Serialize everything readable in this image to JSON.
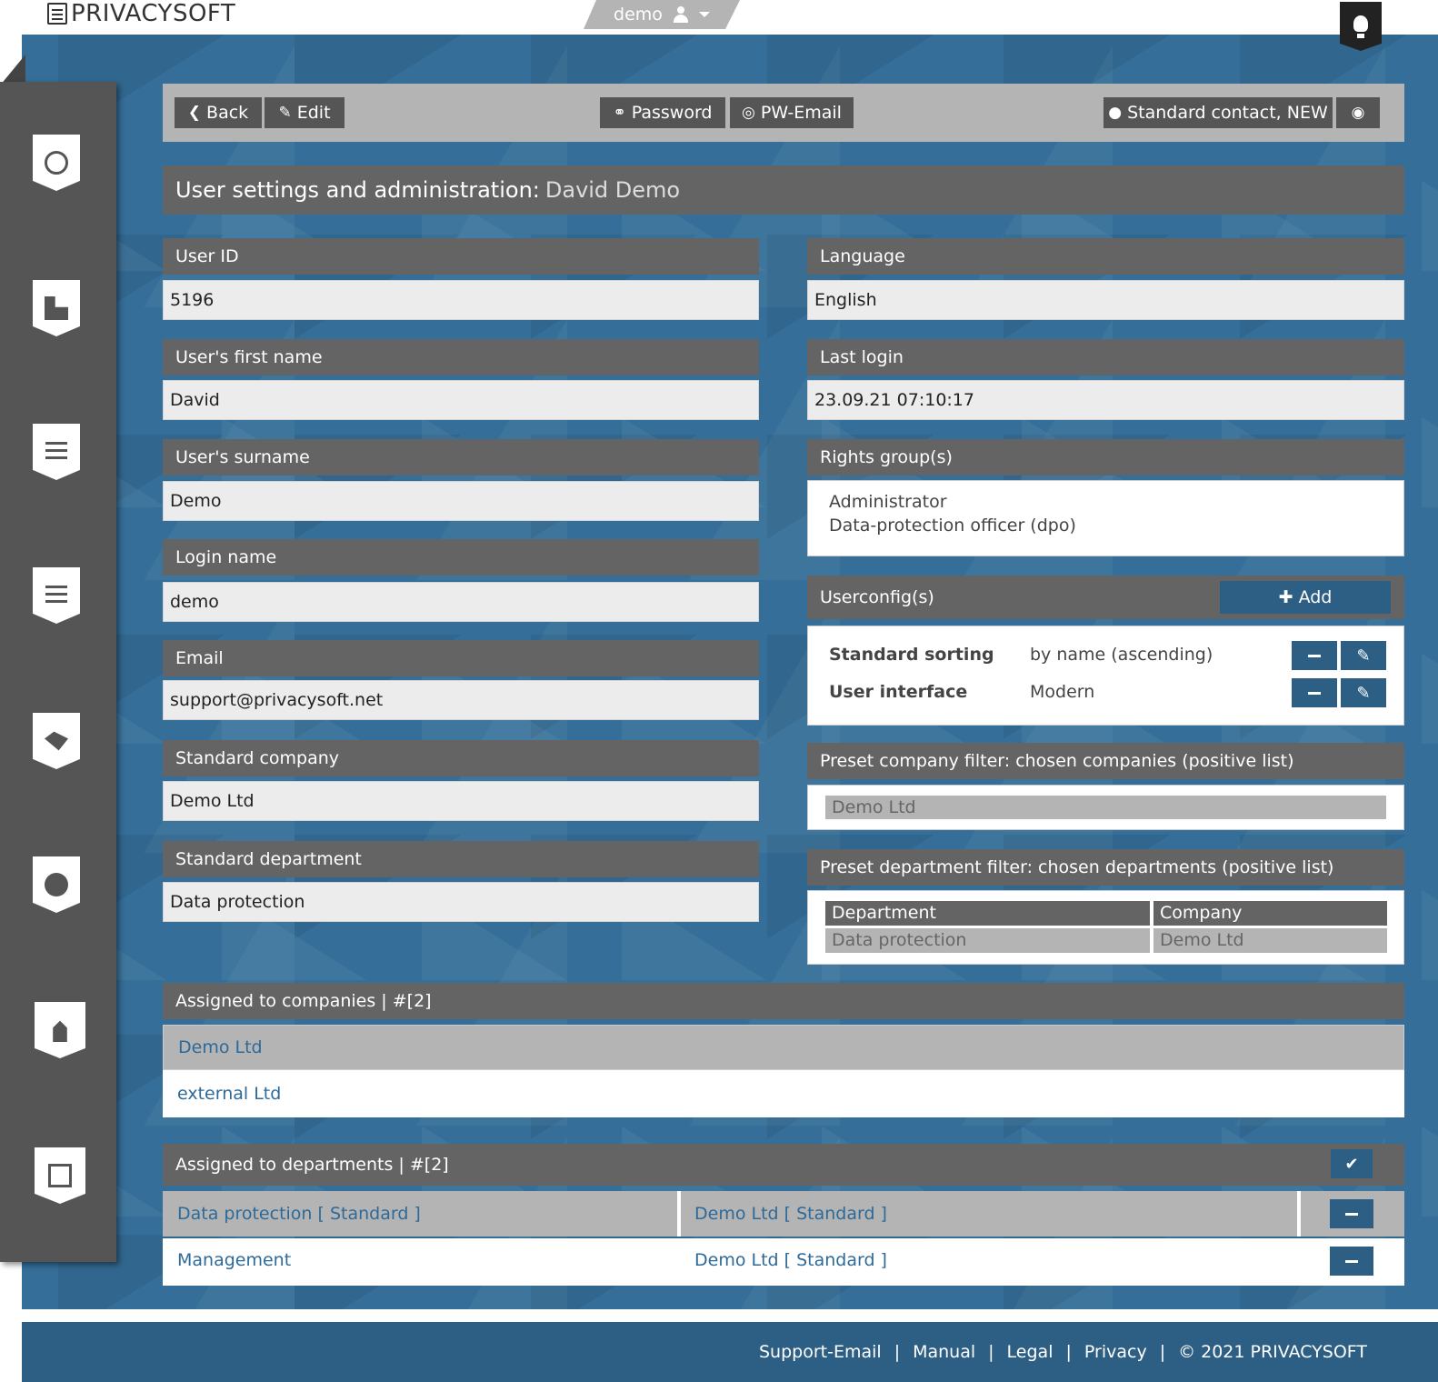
{
  "brand": {
    "name": "PRIVACYSOFT"
  },
  "user_menu": {
    "username": "demo"
  },
  "toolbar": {
    "back": "Back",
    "edit": "Edit",
    "password": "Password",
    "pw_email": "PW-Email",
    "contact": "Standard contact, NEW"
  },
  "page": {
    "title_prefix": "User settings and administration:",
    "title_name": "David Demo"
  },
  "left_fields": [
    {
      "label": "User ID",
      "value": "5196"
    },
    {
      "label": "User's first name",
      "value": "David"
    },
    {
      "label": "User's surname",
      "value": "Demo"
    },
    {
      "label": "Login name",
      "value": "demo"
    },
    {
      "label": "Email",
      "value": "support@privacysoft.net"
    },
    {
      "label": "Standard company",
      "value": "Demo Ltd"
    },
    {
      "label": "Standard department",
      "value": "Data protection"
    }
  ],
  "language": {
    "label": "Language",
    "value": "English"
  },
  "last_login": {
    "label": "Last login",
    "value": "23.09.21 07:10:17"
  },
  "rights": {
    "label": "Rights group(s)",
    "items": [
      "Administrator",
      "Data-protection officer (dpo)"
    ]
  },
  "userconfig": {
    "label": "Userconfig(s)",
    "add": "Add",
    "rows": [
      {
        "key": "Standard sorting",
        "value": "by name (ascending)"
      },
      {
        "key": "User interface",
        "value": "Modern"
      }
    ]
  },
  "company_filter": {
    "label": "Preset company filter: chosen companies (positive list)",
    "items": [
      "Demo Ltd"
    ]
  },
  "department_filter": {
    "label": "Preset department filter: chosen departments (positive list)",
    "headers": [
      "Department",
      "Company"
    ],
    "rows": [
      [
        "Data protection",
        "Demo Ltd"
      ]
    ]
  },
  "assigned_companies": {
    "label": "Assigned to companies | #[2]",
    "items": [
      "Demo Ltd",
      "external Ltd"
    ]
  },
  "assigned_departments": {
    "label": "Assigned to departments | #[2]",
    "rows": [
      {
        "department": "Data protection [ Standard ]",
        "company": "Demo Ltd [ Standard ]"
      },
      {
        "department": "Management",
        "company": "Demo Ltd [ Standard ]"
      }
    ]
  },
  "footer": {
    "links": [
      "Support-Email",
      "Manual",
      "Legal",
      "Privacy"
    ],
    "copyright": "© 2021 PRIVACYSOFT"
  },
  "icons": [
    "globe-icon",
    "puzzle-icon",
    "document-icon",
    "checklist-icon",
    "handshake-icon",
    "stopwatch-icon",
    "alarm-icon",
    "stack-icon",
    "lightbulb-icon",
    "user-icon",
    "eye-icon",
    "pencil-icon",
    "minus-icon",
    "plus-icon",
    "check-icon"
  ],
  "colors": {
    "accent": "#2d5f85",
    "header_gray": "#646464",
    "toolbar_gray": "#b4b4b4",
    "background_blue": "#356f99",
    "sidebar": "#555555"
  }
}
